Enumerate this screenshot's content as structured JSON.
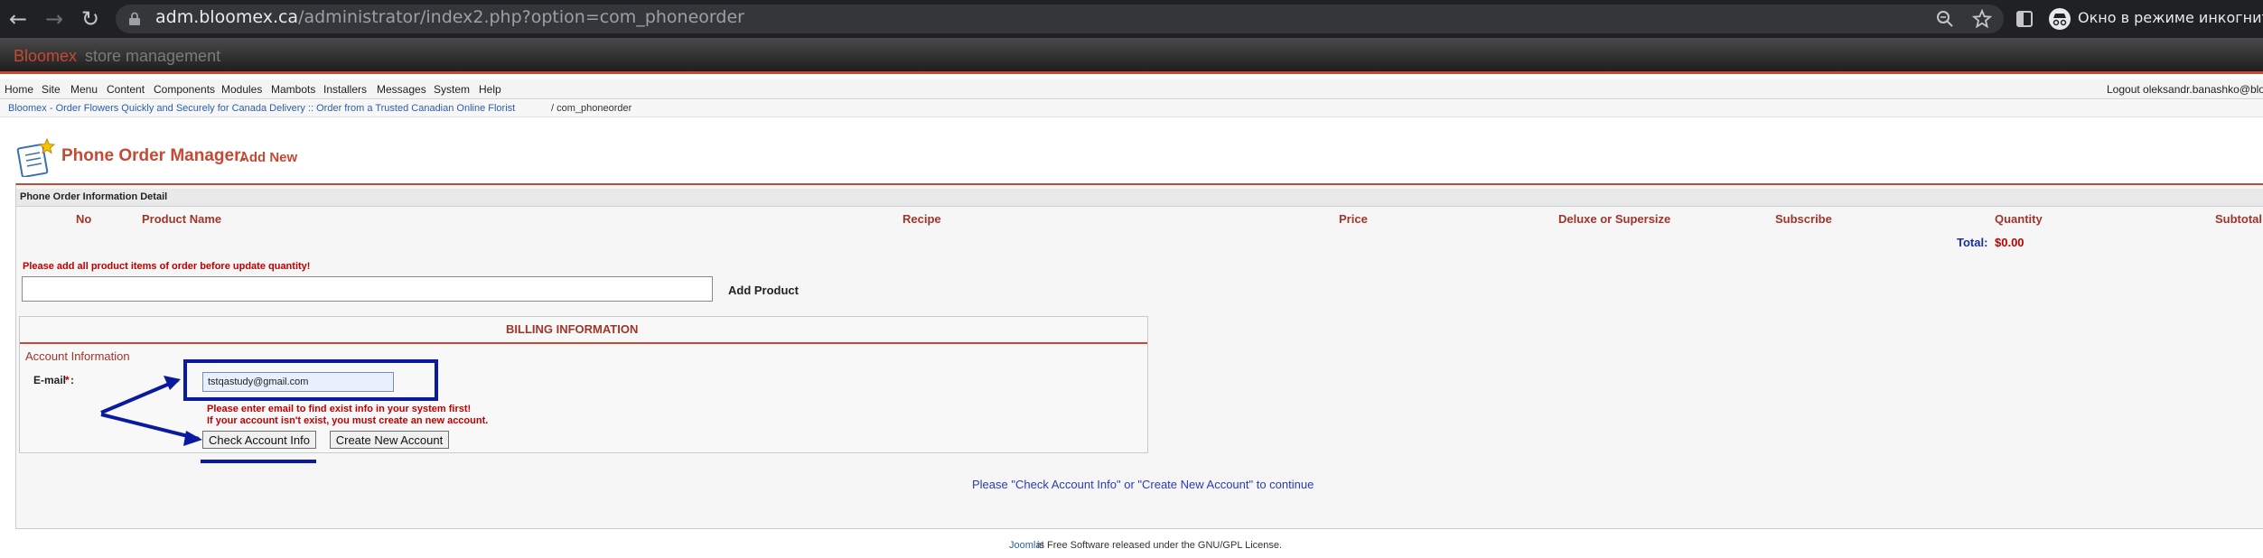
{
  "browser": {
    "url_host": "adm.bloomex.ca",
    "url_path": "/administrator/index2.php?option=com_phoneorder",
    "incognito_label": "Окно в режиме инкогнито"
  },
  "site": {
    "brand": "Bloomex",
    "brand_sub": "store management"
  },
  "menu": {
    "items": [
      "Home",
      "Site",
      "Menu",
      "Content",
      "Components",
      "Modules",
      "Mambots",
      "Installers",
      "Messages",
      "System",
      "Help"
    ],
    "logout": "Logout oleksandr.banashko@blo"
  },
  "breadcrumb": {
    "link": "Bloomex - Order Flowers Quickly and Securely for Canada Delivery :: Order from a Trusted Canadian Online Florist",
    "current": "/ com_phoneorder"
  },
  "page": {
    "title": "Phone Order Manager:",
    "subtitle": "Add New"
  },
  "order": {
    "section_header": "Phone Order Information Detail",
    "columns": [
      "No",
      "Product Name",
      "Recipe",
      "Price",
      "Deluxe or Supersize",
      "Subscribe",
      "Quantity",
      "Subtotal"
    ],
    "total_label": "Total:",
    "total_value": "$0.00",
    "warning": "Please add all product items of order before update quantity!",
    "product_input_value": "",
    "add_product_label": "Add Product"
  },
  "billing": {
    "title": "BILLING INFORMATION",
    "account_info_label": "Account Information",
    "email_label": "E-mail",
    "email_required_mark": "*",
    "email_colon": ":",
    "email_value": "tstqastudy@gmail.com",
    "hint_line_1": "Please enter email to find exist info in your system first!",
    "hint_line_2": "If your account isn't exist, you must create an new account.",
    "check_account_label": "Check Account Info",
    "create_account_label": "Create New Account"
  },
  "continue_text": "Please \"Check Account Info\" or \"Create New Account\" to continue",
  "footer": {
    "link": "Joomla!",
    "text": "is Free Software released under the GNU/GPL License."
  },
  "colors": {
    "accent_red": "#c64934",
    "annotation_blue": "#0a1a9e",
    "error_red": "#c00000"
  },
  "icons": [
    "back-arrow-icon",
    "forward-arrow-icon",
    "reload-icon",
    "lock-icon",
    "zoom-icon",
    "star-icon",
    "sidebar-icon",
    "incognito-icon",
    "phone-order-icon"
  ]
}
